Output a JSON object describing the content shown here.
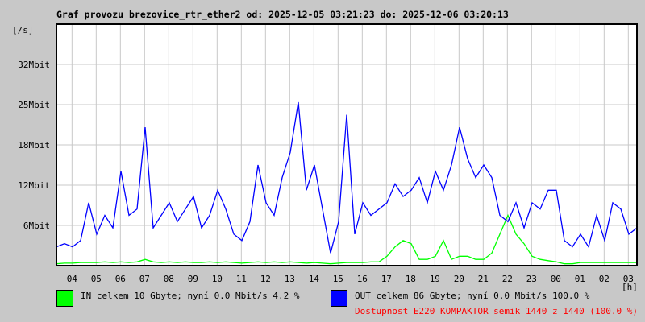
{
  "title": "Graf provozu brezovice_rtr_ether2 od: 2025-12-05 03:21:23 do: 2025-12-06 03:20:13",
  "colors": {
    "in": "#00ff00",
    "out": "#0000ff",
    "availability": "#ff0000",
    "grid": "#c8c8c8"
  },
  "legend": {
    "in": "IN celkem 10 Gbyte; nyní   0.0 Mbit/s 4.2 %",
    "out": "OUT celkem 86 Gbyte; nyní   0.0 Mbit/s 100.0 %",
    "availability": "Dostupnost E220 KOMPAKTOR semik 1440 z 1440 (100.0 %)"
  },
  "chart_data": {
    "type": "line",
    "title": "Graf provozu brezovice_rtr_ether2 od: 2025-12-05 03:21:23 do: 2025-12-06 03:20:13",
    "ylabel": "[/s]",
    "xlabel": "[h]",
    "ylim": [
      0,
      38.4
    ],
    "yticks": [
      {
        "v": 6.4,
        "label": "6Mbit"
      },
      {
        "v": 12.8,
        "label": "12Mbit"
      },
      {
        "v": 19.2,
        "label": "18Mbit"
      },
      {
        "v": 25.6,
        "label": "25Mbit"
      },
      {
        "v": 32,
        "label": "32Mbit"
      }
    ],
    "x_start_hours": 3.356,
    "x_step_minutes": 20,
    "xticks": [
      {
        "h": 4,
        "label": "04"
      },
      {
        "h": 5,
        "label": "05"
      },
      {
        "h": 6,
        "label": "06"
      },
      {
        "h": 7,
        "label": "07"
      },
      {
        "h": 8,
        "label": "08"
      },
      {
        "h": 9,
        "label": "09"
      },
      {
        "h": 10,
        "label": "10"
      },
      {
        "h": 11,
        "label": "11"
      },
      {
        "h": 12,
        "label": "12"
      },
      {
        "h": 13,
        "label": "13"
      },
      {
        "h": 14,
        "label": "14"
      },
      {
        "h": 15,
        "label": "15"
      },
      {
        "h": 16,
        "label": "16"
      },
      {
        "h": 17,
        "label": "17"
      },
      {
        "h": 18,
        "label": "18"
      },
      {
        "h": 19,
        "label": "19"
      },
      {
        "h": 20,
        "label": "20"
      },
      {
        "h": 21,
        "label": "21"
      },
      {
        "h": 22,
        "label": "22"
      },
      {
        "h": 23,
        "label": "23"
      },
      {
        "h": 24,
        "label": "00"
      },
      {
        "h": 25,
        "label": "01"
      },
      {
        "h": 26,
        "label": "02"
      },
      {
        "h": 27,
        "label": "03"
      }
    ],
    "series": [
      {
        "name": "OUT",
        "unit": "Mbit/s",
        "values": [
          3,
          3.5,
          3,
          4,
          10,
          5,
          8,
          6,
          15,
          8,
          9,
          22,
          6,
          8,
          10,
          7,
          9,
          11,
          6,
          8,
          12,
          9,
          5,
          4,
          7,
          16,
          10,
          8,
          14,
          18,
          26,
          12,
          16,
          9,
          2,
          7,
          24,
          5,
          10,
          8,
          9,
          10,
          13,
          11,
          12,
          14,
          10,
          15,
          12,
          16,
          22,
          17,
          14,
          16,
          14,
          8,
          7,
          10,
          6,
          10,
          9,
          12,
          12,
          4,
          3,
          5,
          3,
          8,
          4,
          10,
          9,
          5,
          6
        ]
      },
      {
        "name": "IN",
        "unit": "Mbit/s",
        "values": [
          0.3,
          0.4,
          0.4,
          0.5,
          0.5,
          0.5,
          0.6,
          0.5,
          0.6,
          0.5,
          0.6,
          1,
          0.6,
          0.5,
          0.6,
          0.5,
          0.6,
          0.5,
          0.5,
          0.6,
          0.5,
          0.6,
          0.5,
          0.4,
          0.5,
          0.6,
          0.5,
          0.6,
          0.5,
          0.6,
          0.5,
          0.4,
          0.5,
          0.4,
          0.3,
          0.4,
          0.5,
          0.5,
          0.5,
          0.6,
          0.6,
          1.5,
          3,
          4,
          3.5,
          1,
          1,
          1.5,
          4,
          1,
          1.5,
          1.5,
          1,
          1,
          2,
          5,
          8,
          5,
          3.5,
          1.5,
          1,
          0.8,
          0.6,
          0.3,
          0.3,
          0.5,
          0.5,
          0.5,
          0.5,
          0.5,
          0.5,
          0.5,
          0.5
        ]
      }
    ]
  }
}
